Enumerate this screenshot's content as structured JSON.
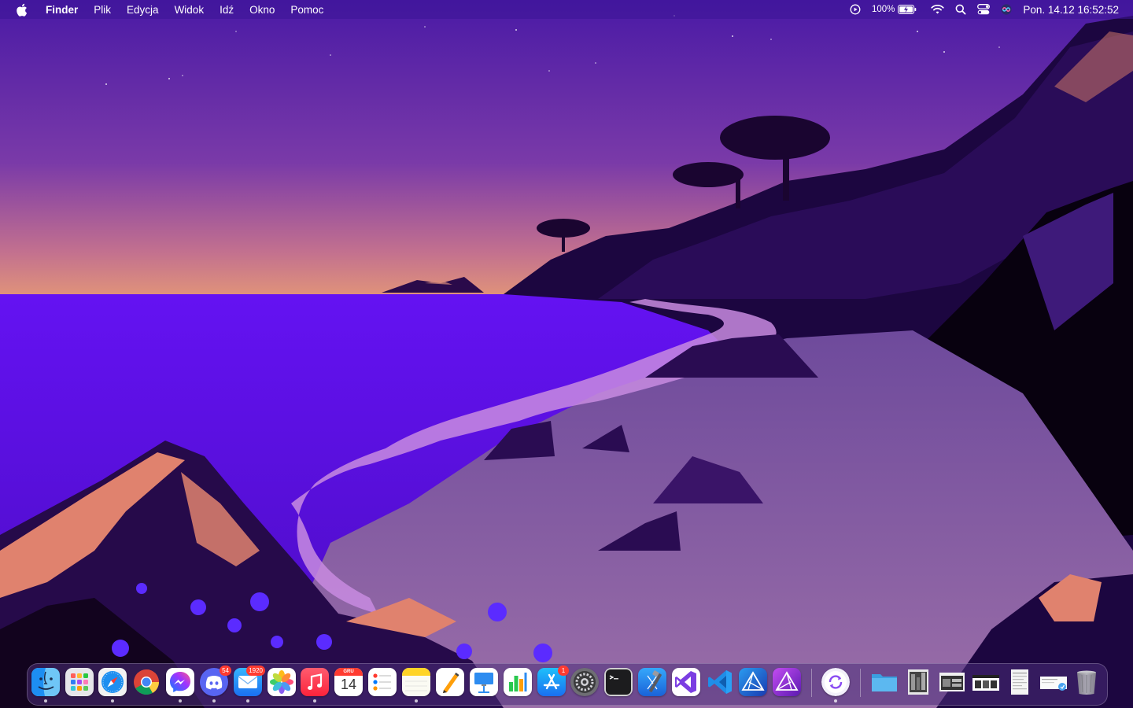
{
  "menubar": {
    "app_name": "Finder",
    "menus": [
      "Plik",
      "Edycja",
      "Widok",
      "Idź",
      "Okno",
      "Pomoc"
    ],
    "battery_percent": "100%",
    "clock": "Pon. 14.12  16:52:52"
  },
  "dock": {
    "items": [
      {
        "name": "Finder",
        "icon": "finder-icon",
        "running": true
      },
      {
        "name": "Launchpad",
        "icon": "launchpad-icon",
        "running": false
      },
      {
        "name": "Safari",
        "icon": "safari-icon",
        "running": true
      },
      {
        "name": "Google Chrome",
        "icon": "chrome-icon",
        "running": false
      },
      {
        "name": "Messenger",
        "icon": "messenger-icon",
        "running": true
      },
      {
        "name": "Discord",
        "icon": "discord-icon",
        "running": true,
        "badge": "54"
      },
      {
        "name": "Mail",
        "icon": "mail-icon",
        "running": true,
        "badge": "1920"
      },
      {
        "name": "Photos",
        "icon": "photos-icon",
        "running": false
      },
      {
        "name": "Music",
        "icon": "music-icon",
        "running": true
      },
      {
        "name": "Calendar",
        "icon": "calendar-icon",
        "running": false,
        "month": "GRU",
        "day": "14"
      },
      {
        "name": "Reminders",
        "icon": "reminders-icon",
        "running": false
      },
      {
        "name": "Notes",
        "icon": "notes-icon",
        "running": true
      },
      {
        "name": "Pages",
        "icon": "pages-icon",
        "running": false
      },
      {
        "name": "Keynote",
        "icon": "keynote-icon",
        "running": false
      },
      {
        "name": "Numbers",
        "icon": "numbers-icon",
        "running": false
      },
      {
        "name": "App Store",
        "icon": "app-store-icon",
        "running": false,
        "badge": "1"
      },
      {
        "name": "System Preferences",
        "icon": "system-preferences-icon",
        "running": false
      },
      {
        "name": "Terminal",
        "icon": "terminal-icon",
        "running": false
      },
      {
        "name": "Xcode",
        "icon": "xcode-icon",
        "running": false
      },
      {
        "name": "Visual Studio",
        "icon": "visual-studio-icon",
        "running": false
      },
      {
        "name": "Visual Studio Code",
        "icon": "vscode-icon",
        "running": false
      },
      {
        "name": "Affinity Designer",
        "icon": "affinity-designer-icon",
        "running": false
      },
      {
        "name": "Affinity Photo",
        "icon": "affinity-photo-icon",
        "running": false
      },
      {
        "name": "Sync App",
        "icon": "sync-icon",
        "running": true
      },
      {
        "name": "Downloads",
        "icon": "folder-icon",
        "running": false
      },
      {
        "name": "Document 1",
        "icon": "document-thumbnail-icon",
        "running": false
      },
      {
        "name": "Document 2",
        "icon": "document-thumbnail-icon",
        "running": false
      },
      {
        "name": "Document 3",
        "icon": "document-thumbnail-icon",
        "running": false
      },
      {
        "name": "Document 4",
        "icon": "document-thumbnail-icon",
        "running": false
      },
      {
        "name": "Document 5",
        "icon": "document-thumbnail-icon",
        "running": false
      },
      {
        "name": "Trash",
        "icon": "trash-icon",
        "running": false
      }
    ]
  },
  "colors": {
    "accent": "#5a1fd6",
    "sky_top": "#4a1aa6",
    "sky_horizon": "#e0937a",
    "sea": "#5d10e6",
    "sand": "#7b55a8",
    "badge": "#ff3b30"
  }
}
